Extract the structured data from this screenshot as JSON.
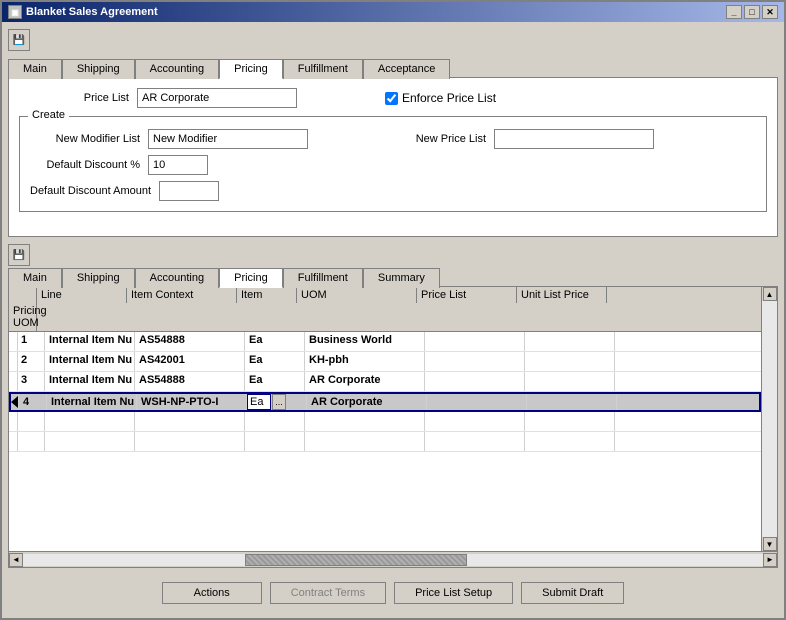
{
  "window": {
    "title": "Blanket Sales Agreement"
  },
  "upper_toolbar": {
    "icon": "📄"
  },
  "upper_tabs": [
    {
      "label": "Main",
      "active": false
    },
    {
      "label": "Shipping",
      "active": false
    },
    {
      "label": "Accounting",
      "active": false
    },
    {
      "label": "Pricing",
      "active": true
    },
    {
      "label": "Fulfillment",
      "active": false
    },
    {
      "label": "Acceptance",
      "active": false
    }
  ],
  "pricing_form": {
    "price_list_label": "Price List",
    "price_list_value": "AR Corporate",
    "enforce_label": "Enforce Price List",
    "create_group_label": "Create",
    "new_modifier_list_label": "New Modifier List",
    "new_modifier_list_value": "New Modifier",
    "new_price_list_label": "New Price List",
    "new_price_list_value": "",
    "default_discount_label": "Default Discount %",
    "default_discount_value": "10",
    "default_discount_amount_label": "Default Discount Amount",
    "default_discount_amount_value": ""
  },
  "lower_toolbar": {
    "icon": "📄"
  },
  "lower_tabs": [
    {
      "label": "Main",
      "active": false
    },
    {
      "label": "Shipping",
      "active": false
    },
    {
      "label": "Accounting",
      "active": false
    },
    {
      "label": "Pricing",
      "active": true
    },
    {
      "label": "Fulfillment",
      "active": false
    },
    {
      "label": "Summary",
      "active": false
    }
  ],
  "table": {
    "columns": [
      "Line",
      "Item Context",
      "Item",
      "UOM",
      "Price List",
      "Unit List Price",
      "Pricing UOM"
    ],
    "rows": [
      {
        "line": "1",
        "item_context": "Internal Item Nu",
        "item": "AS54888",
        "uom": "Ea",
        "price_list": "Business World",
        "unit_list_price": "",
        "pricing_uom": "",
        "selected": false
      },
      {
        "line": "2",
        "item_context": "Internal Item Nu",
        "item": "AS42001",
        "uom": "Ea",
        "price_list": "KH-pbh",
        "unit_list_price": "",
        "pricing_uom": "",
        "selected": false
      },
      {
        "line": "3",
        "item_context": "Internal Item Nu",
        "item": "AS54888",
        "uom": "Ea",
        "price_list": "AR Corporate",
        "unit_list_price": "",
        "pricing_uom": "",
        "selected": false
      },
      {
        "line": "4",
        "item_context": "Internal Item Nu",
        "item": "WSH-NP-PTO-I",
        "uom": "Ea",
        "price_list": "AR Corporate",
        "unit_list_price": "",
        "pricing_uom": "",
        "selected": true,
        "active": true
      },
      {
        "line": "",
        "item_context": "",
        "item": "",
        "uom": "",
        "price_list": "",
        "unit_list_price": "",
        "pricing_uom": "",
        "selected": false
      },
      {
        "line": "",
        "item_context": "",
        "item": "",
        "uom": "",
        "price_list": "",
        "unit_list_price": "",
        "pricing_uom": "",
        "selected": false
      }
    ]
  },
  "bottom_buttons": [
    {
      "label": "Actions",
      "disabled": false
    },
    {
      "label": "Contract Terms",
      "disabled": true
    },
    {
      "label": "Price List Setup",
      "disabled": false
    },
    {
      "label": "Submit Draft",
      "disabled": false
    }
  ]
}
